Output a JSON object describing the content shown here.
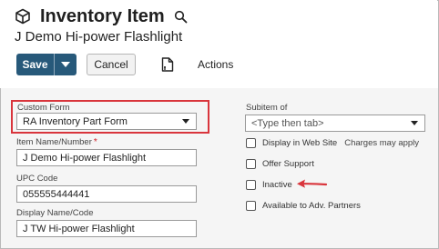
{
  "header": {
    "title": "Inventory Item",
    "subtitle": "J Demo Hi-power Flashlight"
  },
  "toolbar": {
    "save_label": "Save",
    "cancel_label": "Cancel",
    "actions_label": "Actions"
  },
  "form": {
    "custom_form": {
      "label": "Custom Form",
      "value": "RA Inventory Part Form"
    },
    "item_name": {
      "label": "Item Name/Number",
      "value": "J Demo Hi-power Flashlight"
    },
    "upc_code": {
      "label": "UPC Code",
      "value": "055555444441"
    },
    "display_name": {
      "label": "Display Name/Code",
      "value": "J TW Hi-power Flashlight"
    },
    "subitem_of": {
      "label": "Subitem of",
      "placeholder": "<Type then tab>"
    },
    "checkboxes": [
      {
        "label": "Display in Web Site",
        "note": "Charges may apply",
        "checked": false
      },
      {
        "label": "Offer Support",
        "checked": false
      },
      {
        "label": "Inactive",
        "checked": false
      },
      {
        "label": "Available to Adv. Partners",
        "checked": false
      }
    ]
  },
  "colors": {
    "primary_button": "#27597a",
    "highlight_border": "#d9353c",
    "arrow": "#d9353c",
    "required_marker": "#d0202a"
  },
  "icons": {
    "record_type": "cube-icon",
    "search": "search-icon",
    "save_menu": "caret-down-icon",
    "print": "print-icon"
  }
}
